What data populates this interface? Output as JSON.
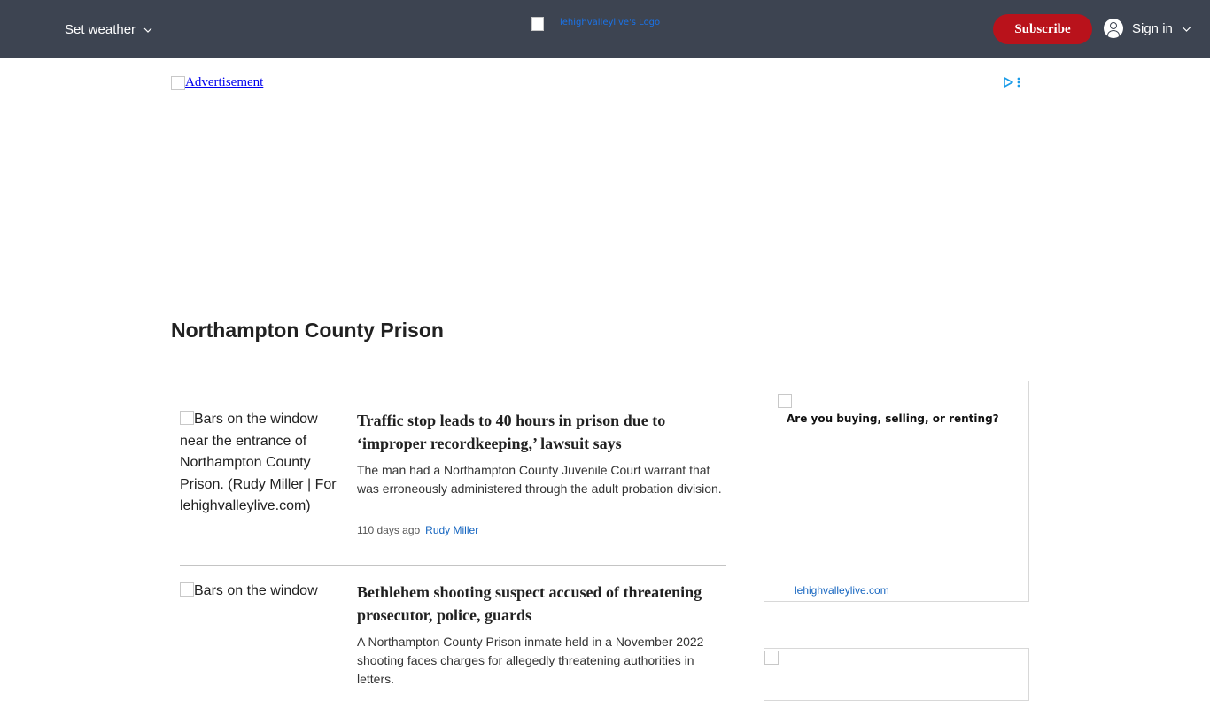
{
  "header": {
    "weather_label": "Set weather",
    "logo_alt": "lehighvalleylive's Logo",
    "subscribe_label": "Subscribe",
    "signin_label": "Sign in",
    "background": "#3d4451",
    "subscribe_color": "#b9121b"
  },
  "ad": {
    "alt": "Advertisement"
  },
  "page": {
    "title": "Northampton County Prison"
  },
  "articles": [
    {
      "image_alt": "Bars on the window near the entrance of Northampton County Prison. (Rudy Miller | For lehighvalleylive.com)",
      "headline": "Traffic stop leads to 40 hours in prison due to ‘improper recordkeeping,’ lawsuit says",
      "summary": "The man had a Northampton County Juvenile Court warrant that was erroneously administered through the adult probation division.",
      "time": "110 days ago",
      "author": "Rudy Miller"
    },
    {
      "image_alt": "Bars on the window",
      "headline": "Bethlehem shooting suspect accused of threatening prosecutor, police, guards",
      "summary": "A Northampton County Prison inmate held in a November 2022 shooting faces charges for allegedly threatening authorities in letters."
    }
  ],
  "rail": {
    "promo_heading": "Are you buying, selling, or renting?",
    "promo_source": "lehighvalleylive.com"
  },
  "colors": {
    "link_blue": "#1565c0",
    "text": "#212121"
  }
}
